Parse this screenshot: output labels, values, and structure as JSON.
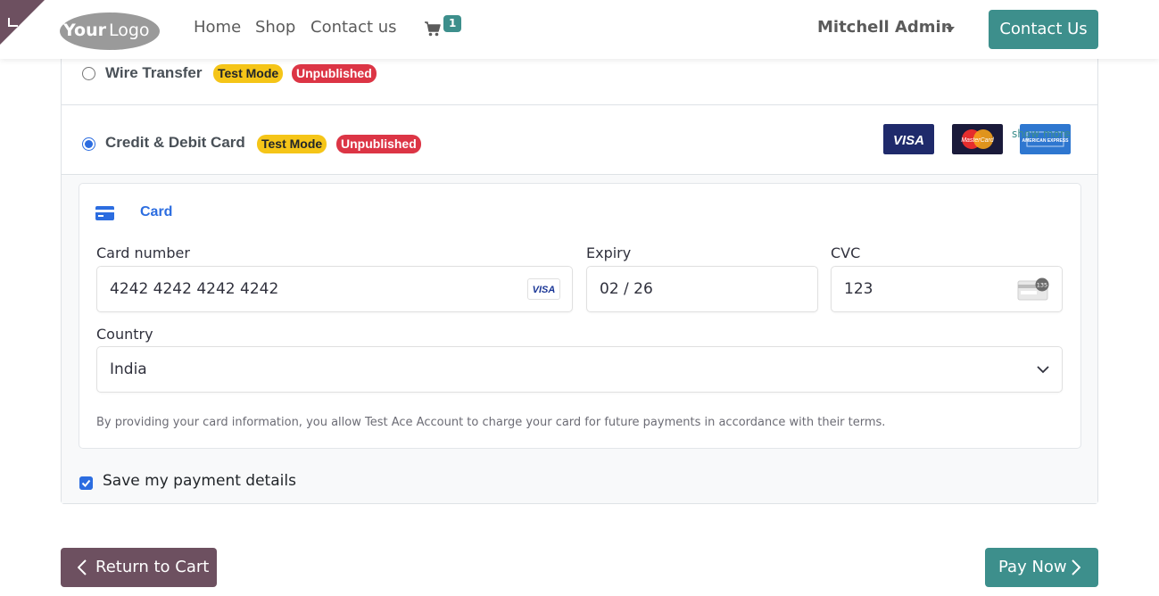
{
  "header": {
    "logo_text": "YourLogo",
    "nav": [
      "Home",
      "Shop",
      "Contact us"
    ],
    "cart_count": "1",
    "user_name": "Mitchell Admin",
    "contact_button": "Contact Us"
  },
  "payment_methods": [
    {
      "name": "Wire Transfer",
      "selected": false,
      "badges": [
        "Test Mode",
        "Unpublished"
      ]
    },
    {
      "name": "Credit & Debit Card",
      "selected": true,
      "badges": [
        "Test Mode",
        "Unpublished"
      ],
      "brands": [
        "VISA",
        "MasterCard",
        "AMERICAN EXPRESS"
      ],
      "show_more": "show more"
    }
  ],
  "card_form": {
    "tab_label": "Card",
    "card_number_label": "Card number",
    "card_number_value": "4242 4242 4242 4242",
    "card_brand": "VISA",
    "expiry_label": "Expiry",
    "expiry_value": "02 / 26",
    "cvc_label": "CVC",
    "cvc_value": "123",
    "cvc_icon_text": "135",
    "country_label": "Country",
    "country_value": "India",
    "terms": "By providing your card information, you allow Test Ace Account to charge your card for future payments in accordance with their terms."
  },
  "save_details": {
    "label": "Save my payment details",
    "checked": true
  },
  "actions": {
    "return_label": "Return to Cart",
    "pay_label": "Pay Now"
  },
  "colors": {
    "primary": "#3d8f8c",
    "secondary": "#6d5060",
    "stripe_blue": "#2c6de0",
    "badge_warning": "#f5c518",
    "badge_danger": "#dc3545"
  }
}
